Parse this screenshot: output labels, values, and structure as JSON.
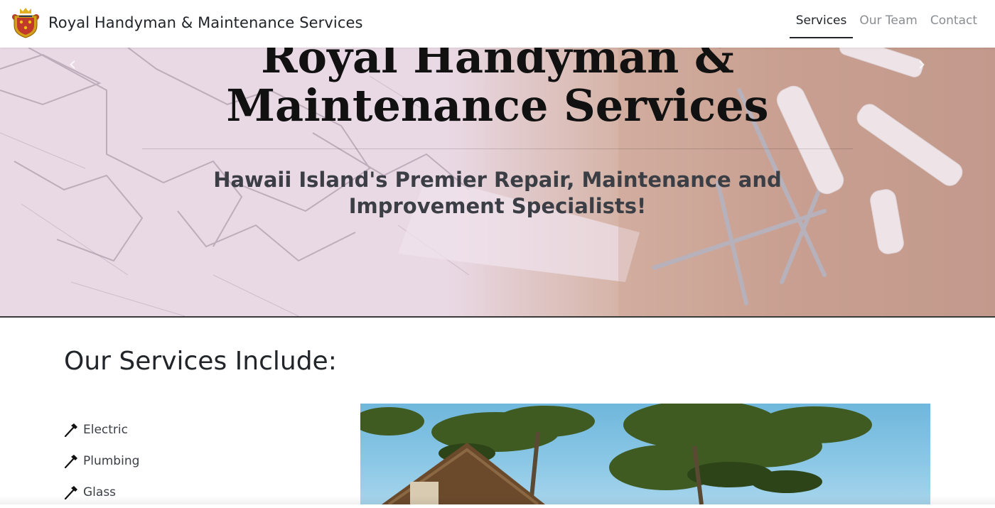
{
  "navbar": {
    "brand_name": "Royal Handyman & Maintenance Services",
    "links": [
      {
        "label": "Services",
        "active": true
      },
      {
        "label": "Our Team",
        "active": false
      },
      {
        "label": "Contact",
        "active": false
      }
    ]
  },
  "hero": {
    "title": "Royal Handyman & Maintenance Services",
    "subtitle": "Hawaii Island's Premier Repair, Maintenance and Improvement Specialists!",
    "prev_arrow": "‹",
    "next_arrow": "›"
  },
  "services": {
    "heading": "Our Services Include:",
    "items": [
      {
        "label": "Electric",
        "icon": "hammer-icon"
      },
      {
        "label": "Plumbing",
        "icon": "hammer-icon"
      },
      {
        "label": "Glass",
        "icon": "hammer-icon"
      }
    ]
  },
  "colors": {
    "text": "#212529",
    "nav_inactive": "#8a8d91",
    "hero_overlay": "#e8d4e4"
  }
}
